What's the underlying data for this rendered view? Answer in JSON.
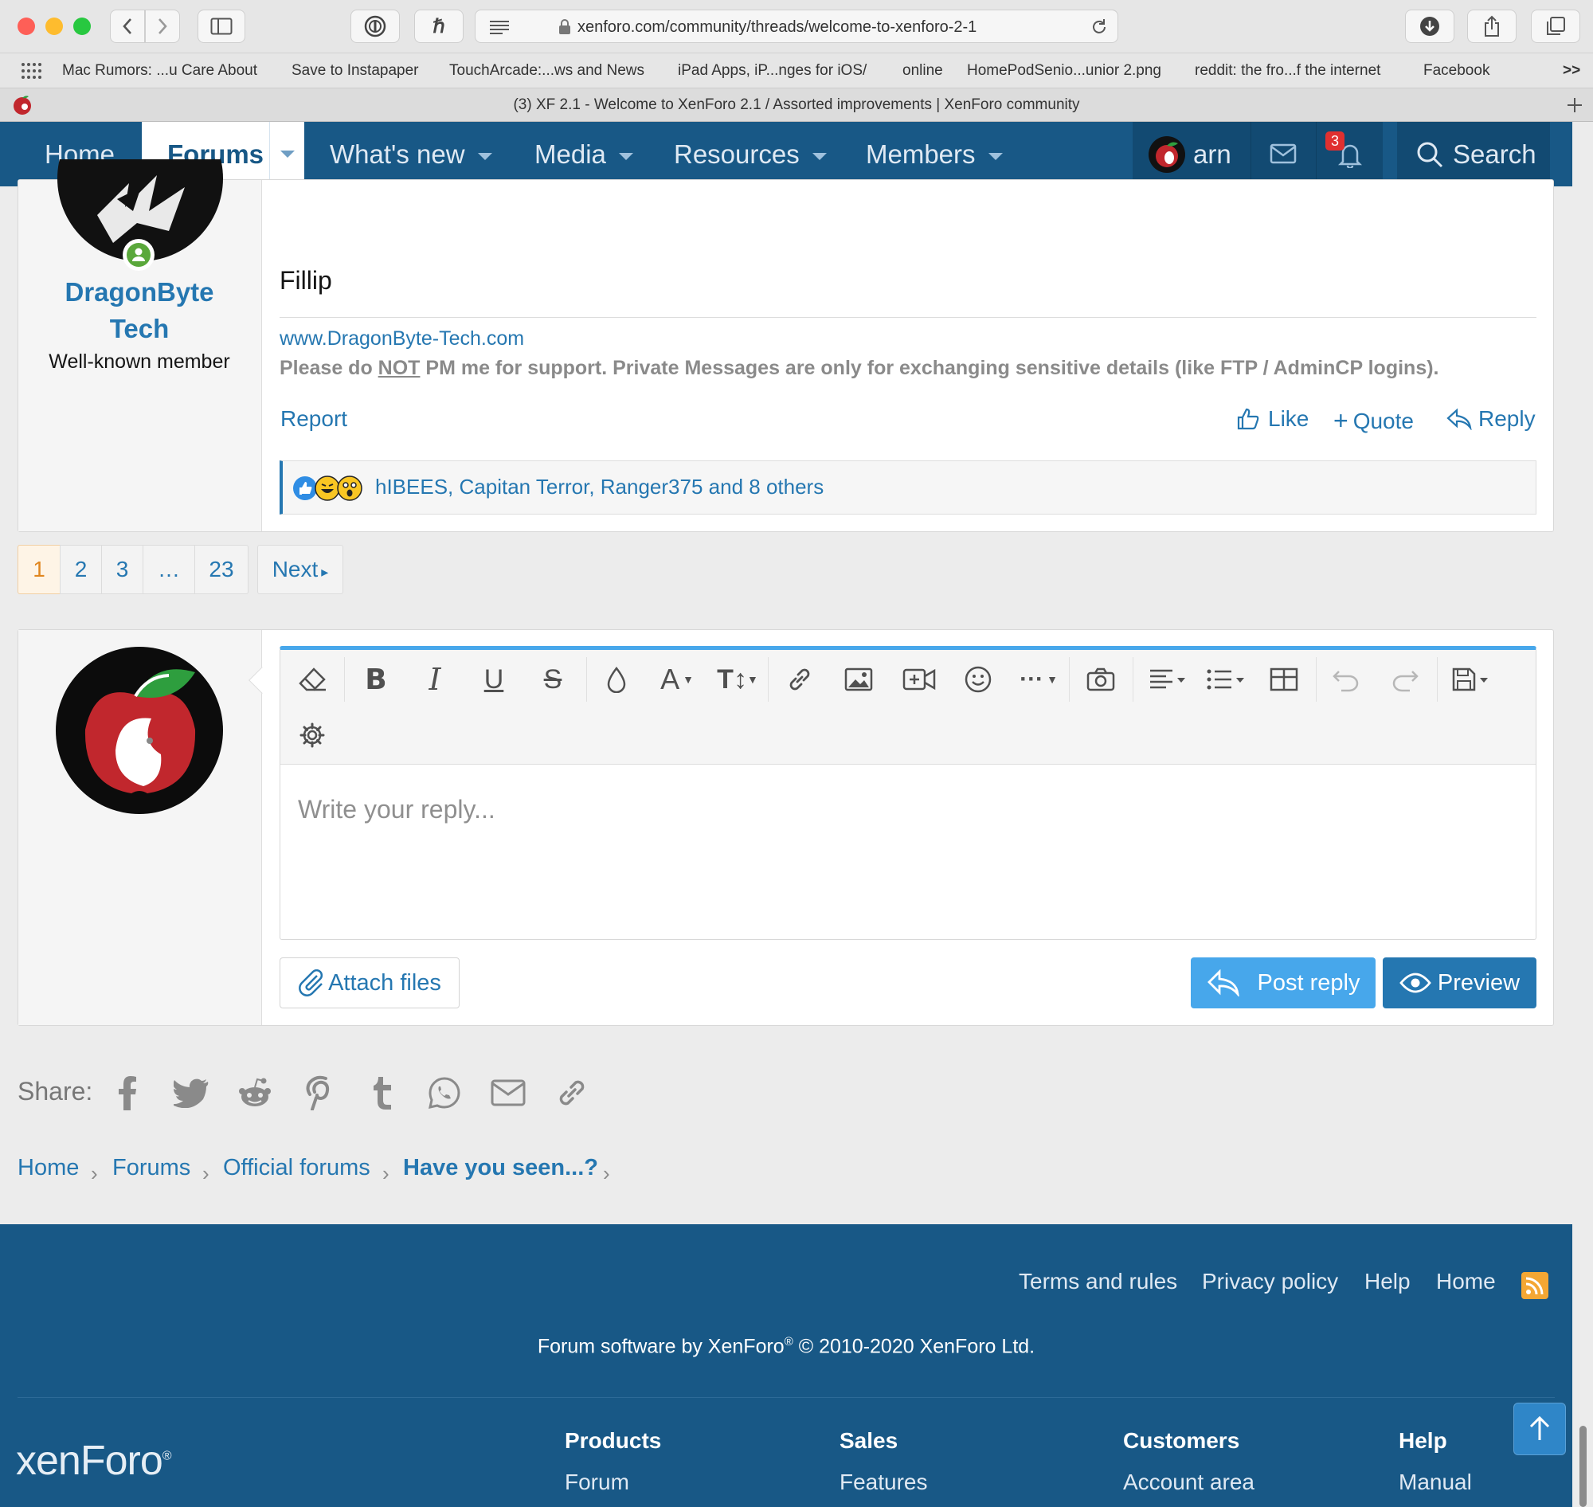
{
  "browser": {
    "url": "xenforo.com/community/threads/welcome-to-xenforo-2-1",
    "tab_title": "(3) XF 2.1 - Welcome to XenForo 2.1 / Assorted improvements | XenForo community",
    "bookmarks": [
      "Mac Rumors: ...u Care About",
      "Save to Instapaper",
      "TouchArcade:...ws and News",
      "iPad Apps, iP...nges for iOS/",
      "online",
      "HomePodSenio...unior 2.png",
      "reddit: the fro...f the internet",
      "Facebook"
    ],
    "overflow": ">>"
  },
  "nav": {
    "home": "Home",
    "forums": "Forums",
    "whats_new": "What's new",
    "media": "Media",
    "resources": "Resources",
    "members": "Members",
    "username": "arn",
    "alerts_count": "3",
    "search": "Search"
  },
  "post": {
    "author_line1": "DragonByte",
    "author_line2": "Tech",
    "user_title": "Well-known member",
    "signature_name": "Fillip",
    "site_link": "www.DragonByte-Tech.com",
    "notice_pre": "Please do ",
    "notice_not": "NOT",
    "notice_post": " PM me for support. Private Messages are only for exchanging sensitive details (like FTP / AdminCP logins).",
    "report": "Report",
    "like": "Like",
    "quote": "Quote",
    "reply": "Reply",
    "reactions_text": "hIBEES, Capitan Terror, Ranger375 and 8 others"
  },
  "pagination": {
    "pages": [
      "1",
      "2",
      "3",
      "…",
      "23"
    ],
    "current": "1",
    "next": "Next"
  },
  "editor": {
    "placeholder": "Write your reply...",
    "attach": "Attach files",
    "post_reply": "Post reply",
    "preview": "Preview"
  },
  "share": {
    "label": "Share:"
  },
  "breadcrumb": [
    "Home",
    "Forums",
    "Official forums",
    "Have you seen...?"
  ],
  "footer": {
    "links": [
      "Terms and rules",
      "Privacy policy",
      "Help",
      "Home"
    ],
    "copyright_pre": "Forum software by XenForo",
    "copyright_reg": "®",
    "copyright_post": " © 2010-2020 XenForo Ltd.",
    "logo_text": "xenForo",
    "columns": [
      {
        "heading": "Products",
        "item": "Forum"
      },
      {
        "heading": "Sales",
        "item": "Features"
      },
      {
        "heading": "Customers",
        "item": "Account area"
      },
      {
        "heading": "Help",
        "item": "Manual"
      }
    ]
  },
  "colors": {
    "nav": "#185886",
    "link": "#2577b1",
    "button_primary": "#47a7eb",
    "button_preview": "#2577b1",
    "current_page": "#fef4e6"
  }
}
